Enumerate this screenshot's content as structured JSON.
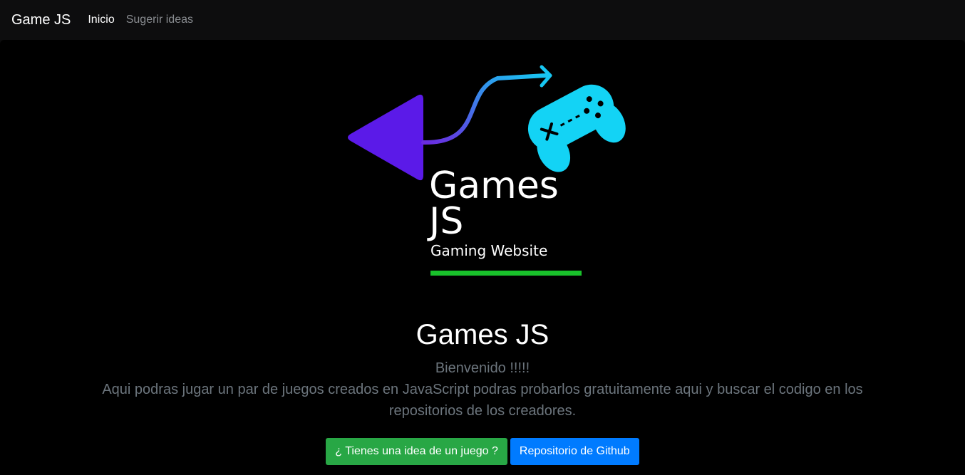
{
  "navbar": {
    "brand": "Game JS",
    "links": [
      {
        "label": "Inicio",
        "active": true
      },
      {
        "label": "Sugerir ideas",
        "active": false
      }
    ]
  },
  "logo": {
    "title_line1": "Games",
    "title_line2": "JS",
    "tagline": "Gaming Website",
    "colors": {
      "triangle": "#5b1ae8",
      "controller": "#13d3f5",
      "arrow_start": "#6a2be0",
      "arrow_end": "#17c7f2",
      "underline": "#19c22b",
      "text": "#ffffff"
    },
    "icons": [
      "play-triangle-icon",
      "curved-arrow-icon",
      "gamepad-icon"
    ]
  },
  "hero": {
    "title": "Games JS",
    "welcome": "Bienvenido !!!!!",
    "description": "Aqui podras jugar un par de juegos creados en JavaScript podras probarlos gratuitamente aqui y buscar el codigo en los repositorios de los creadores."
  },
  "actions": {
    "idea_button": "¿ Tienes una idea de un juego ?",
    "github_button": "Repositorio de Github"
  },
  "colors": {
    "page_bg": "#000000",
    "navbar_bg": "#0d0d0e",
    "muted_text": "#6c757d",
    "success": "#28a745",
    "primary": "#007bff"
  }
}
